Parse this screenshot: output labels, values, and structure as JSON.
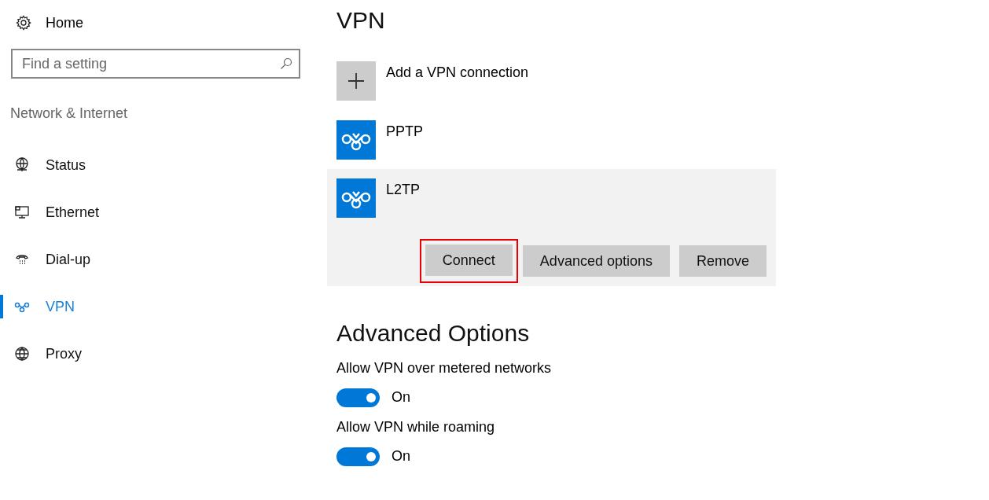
{
  "sidebar": {
    "home": "Home",
    "search": {
      "placeholder": "Find a setting"
    },
    "section": "Network & Internet",
    "items": [
      {
        "label": "Status",
        "kind": "status",
        "selected": false
      },
      {
        "label": "Ethernet",
        "kind": "ethernet",
        "selected": false
      },
      {
        "label": "Dial-up",
        "kind": "dialup",
        "selected": false
      },
      {
        "label": "VPN",
        "kind": "vpn",
        "selected": true
      },
      {
        "label": "Proxy",
        "kind": "proxy",
        "selected": false
      }
    ]
  },
  "main": {
    "title": "VPN",
    "add_label": "Add a VPN connection",
    "connections": [
      {
        "name": "PPTP",
        "expanded": false
      },
      {
        "name": "L2TP",
        "expanded": true,
        "buttons": [
          {
            "label": "Connect",
            "highlighted": true
          },
          {
            "label": "Advanced options",
            "highlighted": false
          },
          {
            "label": "Remove",
            "highlighted": false
          }
        ]
      }
    ],
    "advanced_title": "Advanced Options",
    "options": [
      {
        "label": "Allow VPN over metered networks",
        "on": true,
        "state_text": "On"
      },
      {
        "label": "Allow VPN while roaming",
        "on": true,
        "state_text": "On"
      }
    ]
  }
}
